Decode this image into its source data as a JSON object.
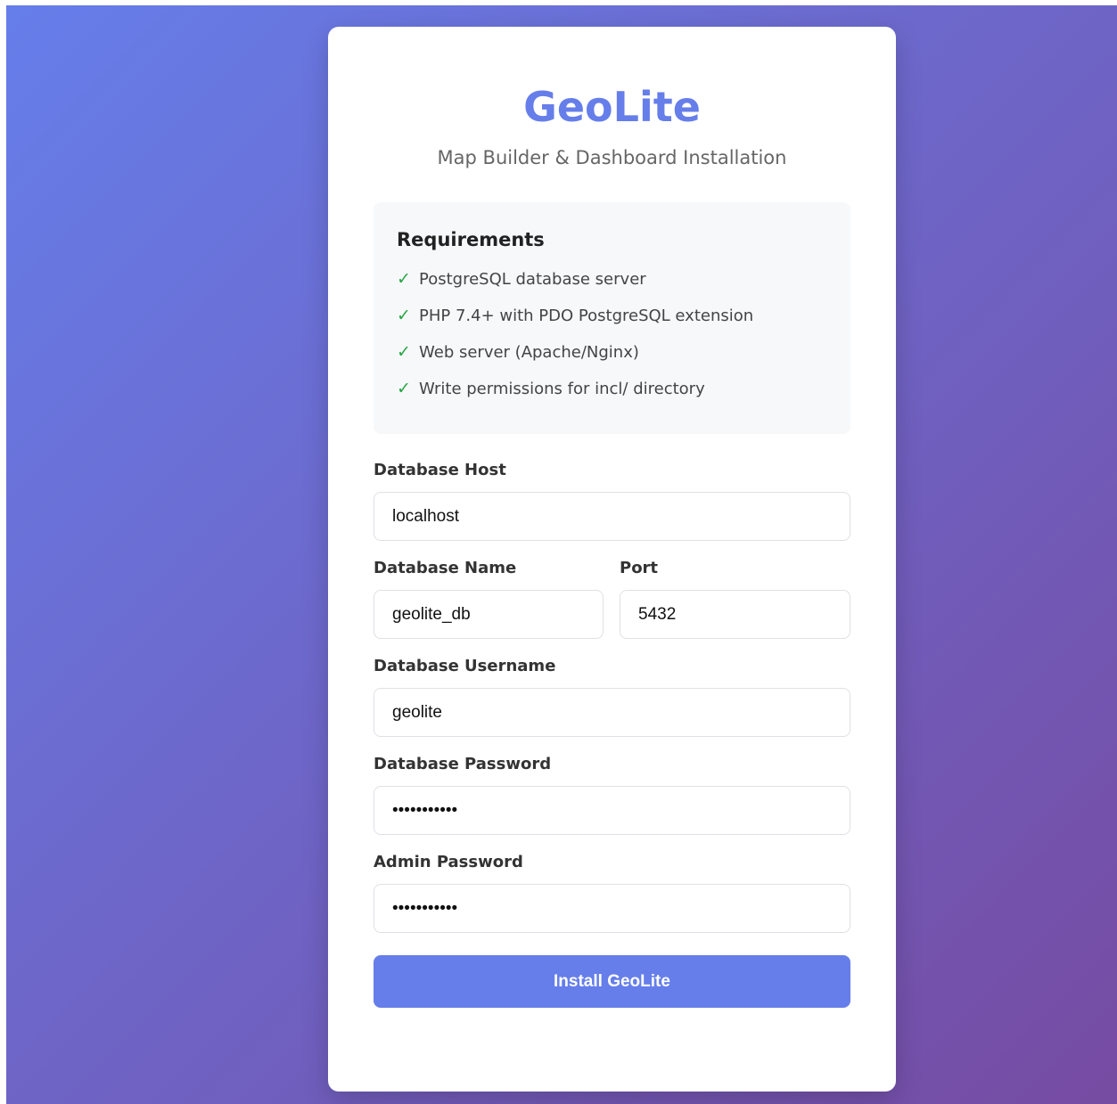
{
  "header": {
    "title": "GeoLite",
    "subtitle": "Map Builder & Dashboard Installation"
  },
  "requirements": {
    "title": "Requirements",
    "check_glyph": "✓",
    "check_color": "#28a745",
    "items": [
      "PostgreSQL database server",
      "PHP 7.4+ with PDO PostgreSQL extension",
      "Web server (Apache/Nginx)",
      "Write permissions for incl/ directory"
    ]
  },
  "form": {
    "db_host": {
      "label": "Database Host",
      "value": "localhost"
    },
    "db_name": {
      "label": "Database Name",
      "value": "geolite_db"
    },
    "port": {
      "label": "Port",
      "value": "5432"
    },
    "db_username": {
      "label": "Database Username",
      "value": "geolite"
    },
    "db_password": {
      "label": "Database Password",
      "value": "***********"
    },
    "admin_password": {
      "label": "Admin Password",
      "value": "***********"
    },
    "submit_label": "Install GeoLite"
  },
  "colors": {
    "accent": "#667eea",
    "background_gradient_start": "#667eea",
    "background_gradient_end": "#764ba2"
  }
}
